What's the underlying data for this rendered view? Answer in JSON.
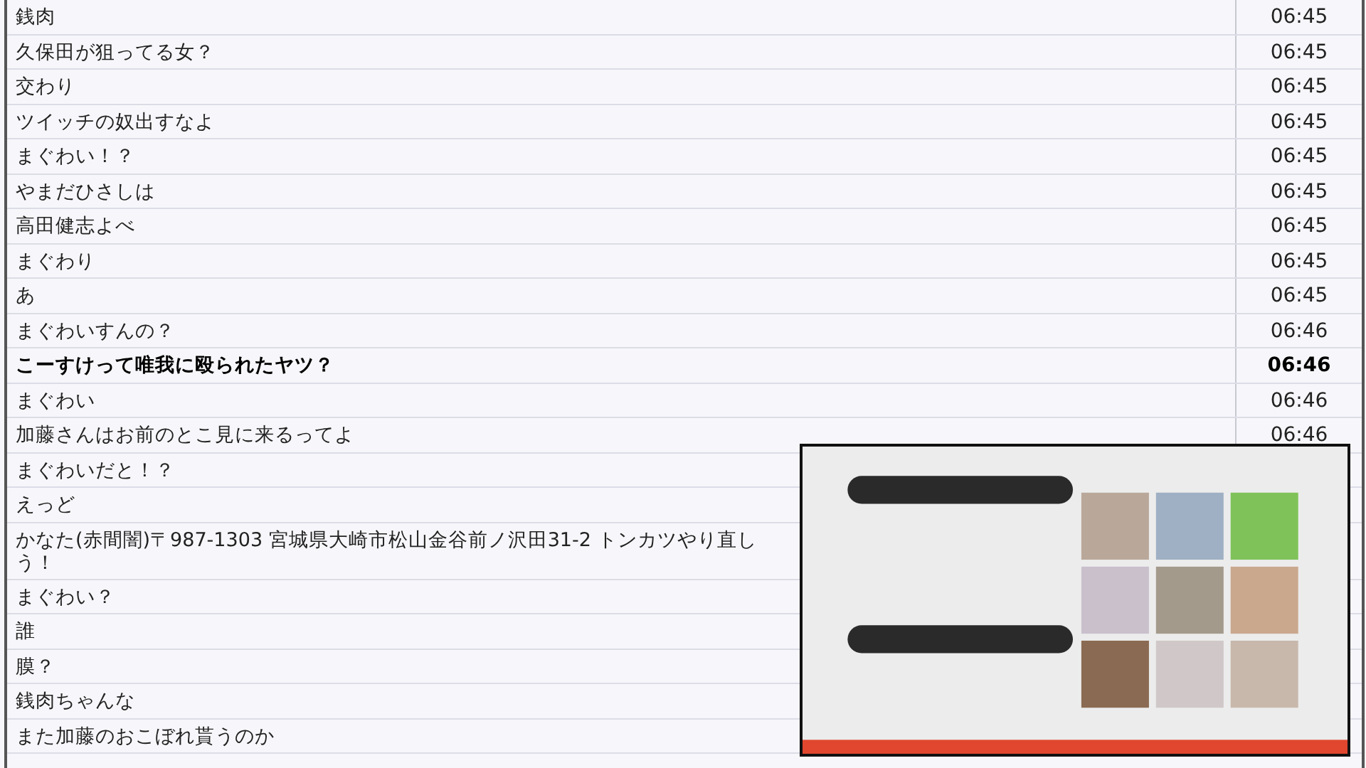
{
  "comments": [
    {
      "text": "銭肉",
      "time": "06:45",
      "bold": false
    },
    {
      "text": "久保田が狙ってる女？",
      "time": "06:45",
      "bold": false
    },
    {
      "text": "交わり",
      "time": "06:45",
      "bold": false
    },
    {
      "text": "ツイッチの奴出すなよ",
      "time": "06:45",
      "bold": false
    },
    {
      "text": "まぐわい！？",
      "time": "06:45",
      "bold": false
    },
    {
      "text": "やまだひさしは",
      "time": "06:45",
      "bold": false
    },
    {
      "text": "高田健志よべ",
      "time": "06:45",
      "bold": false
    },
    {
      "text": "まぐわり",
      "time": "06:45",
      "bold": false
    },
    {
      "text": "あ",
      "time": "06:45",
      "bold": false
    },
    {
      "text": "まぐわいすんの？",
      "time": "06:46",
      "bold": false
    },
    {
      "text": "こーすけって唯我に殴られたヤツ？",
      "time": "06:46",
      "bold": true
    },
    {
      "text": "まぐわい",
      "time": "06:46",
      "bold": false
    },
    {
      "text": "加藤さんはお前のとこ見に来るってよ",
      "time": "06:46",
      "bold": false
    },
    {
      "text": "まぐわいだと！？",
      "bold": false
    },
    {
      "text": "えっど",
      "bold": false
    },
    {
      "text": "かなた(赤間闇)〒987-1303 宮城県大崎市松山金谷前ノ沢田31-2 トンカツやり直しう！",
      "bold": false
    },
    {
      "text": "まぐわい？",
      "bold": false
    },
    {
      "text": "誰",
      "bold": false
    },
    {
      "text": "膜？",
      "bold": false
    },
    {
      "text": "銭肉ちゃんな",
      "bold": false
    },
    {
      "text": "また加藤のおこぼれ貰うのか",
      "bold": false
    }
  ]
}
